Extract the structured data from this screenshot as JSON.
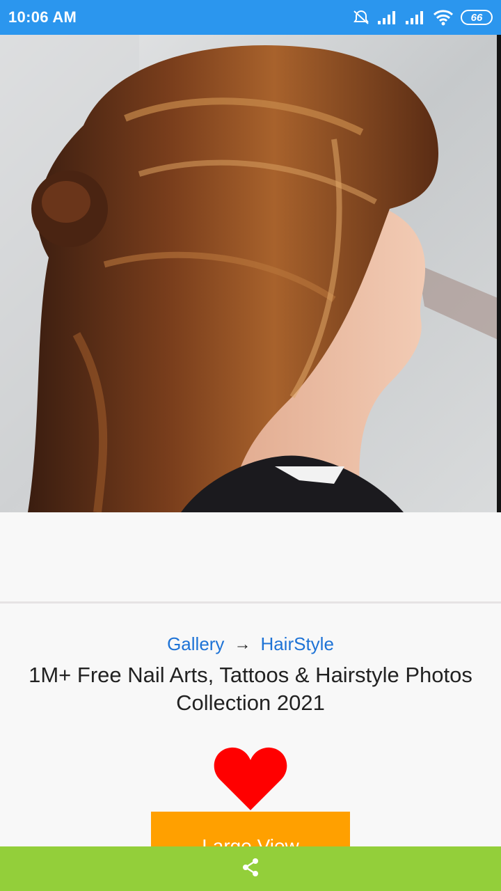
{
  "status_bar": {
    "time": "10:06 AM",
    "battery_level": "66",
    "icons": [
      "alarm-off-icon",
      "signal-icon",
      "signal-icon",
      "wifi-icon",
      "battery-icon"
    ],
    "background_color": "#2b96ee"
  },
  "main": {
    "photo_icon": "hairstyle-photo",
    "breadcrumb": {
      "gallery_label": "Gallery",
      "arrow": "→",
      "category_label": "HairStyle"
    },
    "title": "1M+ Free Nail Arts, Tattoos & Hairstyle Photos Collection 2021",
    "favorite_icon": "heart-icon",
    "large_view_label": "Large View",
    "large_view_color": "#ffa000"
  },
  "bottom_bar": {
    "share_icon": "share-icon",
    "background_color": "#93cf3a"
  }
}
